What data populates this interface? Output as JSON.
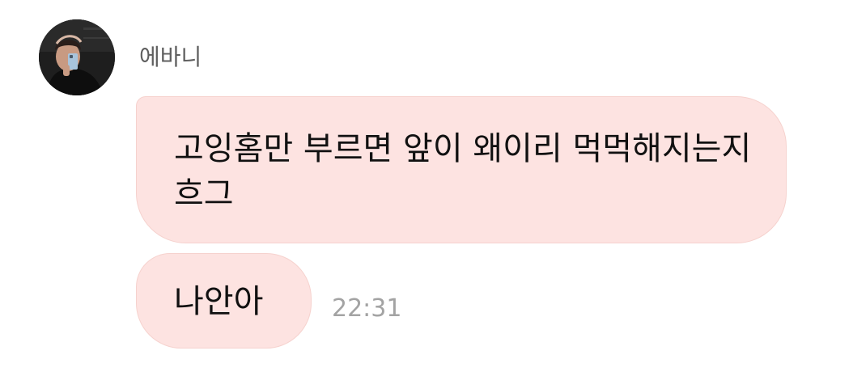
{
  "sender": {
    "name": "에바니",
    "avatar_icon": "profile-photo"
  },
  "messages": [
    {
      "text": "고잉홈만 부르면 앞이 왜이리 먹먹해지는지 흐그"
    },
    {
      "text": "나안아",
      "time": "22:31"
    }
  ],
  "colors": {
    "bubble_background": "#fde3e1",
    "bubble_border": "#f6d2ce",
    "name_text": "#5f5f5f",
    "time_text": "#a3a3a3"
  }
}
